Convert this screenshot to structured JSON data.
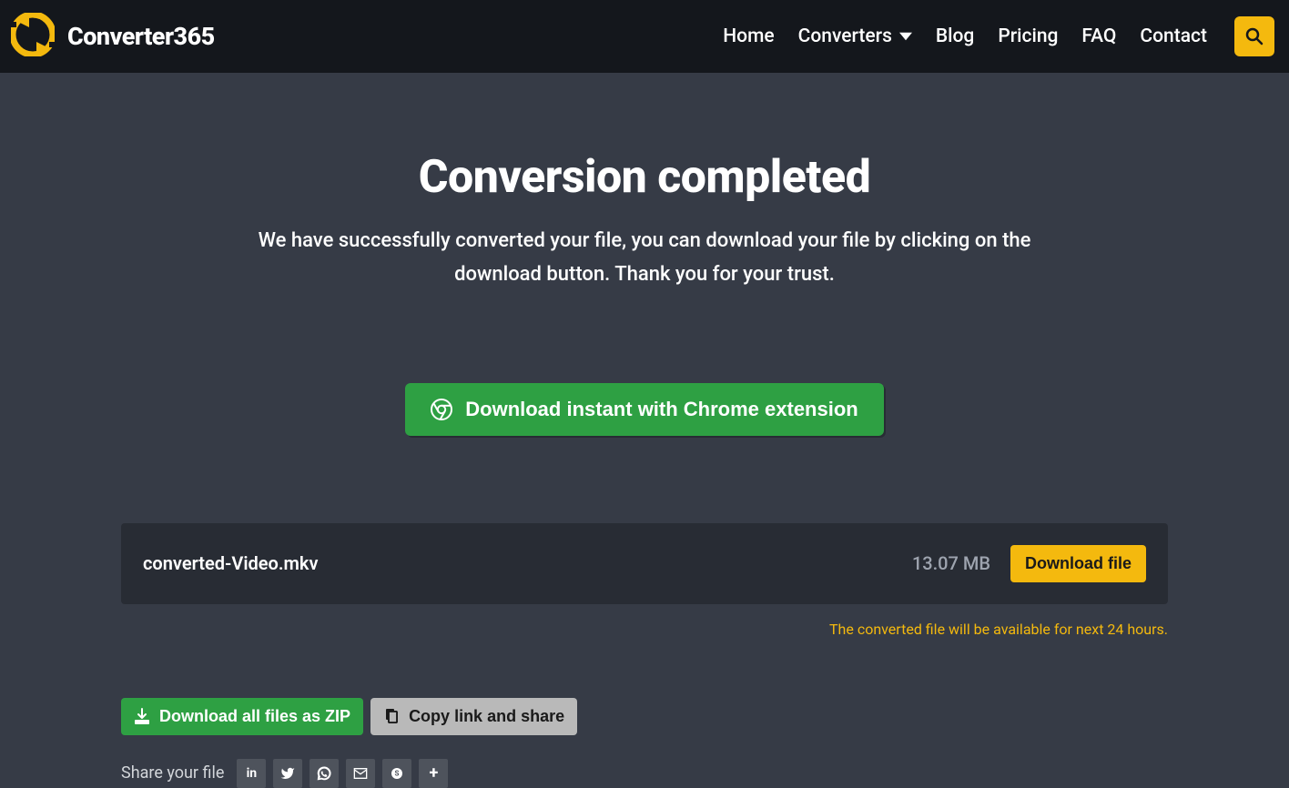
{
  "brand": {
    "name": "Converter365"
  },
  "nav": {
    "home": "Home",
    "converters": "Converters",
    "blog": "Blog",
    "pricing": "Pricing",
    "faq": "FAQ",
    "contact": "Contact"
  },
  "main": {
    "title": "Conversion completed",
    "subtitle": "We have successfully converted your file, you can download your file by clicking on the download button. Thank you for your trust.",
    "chrome_button": "Download instant with Chrome extension"
  },
  "file": {
    "name": "converted-Video.mkv",
    "size": "13.07 MB",
    "download_label": "Download file",
    "notice": "The converted file will be available for next 24 hours."
  },
  "actions": {
    "zip_label": "Download all files as ZIP",
    "copy_label": "Copy link and share",
    "share_label": "Share your file"
  }
}
